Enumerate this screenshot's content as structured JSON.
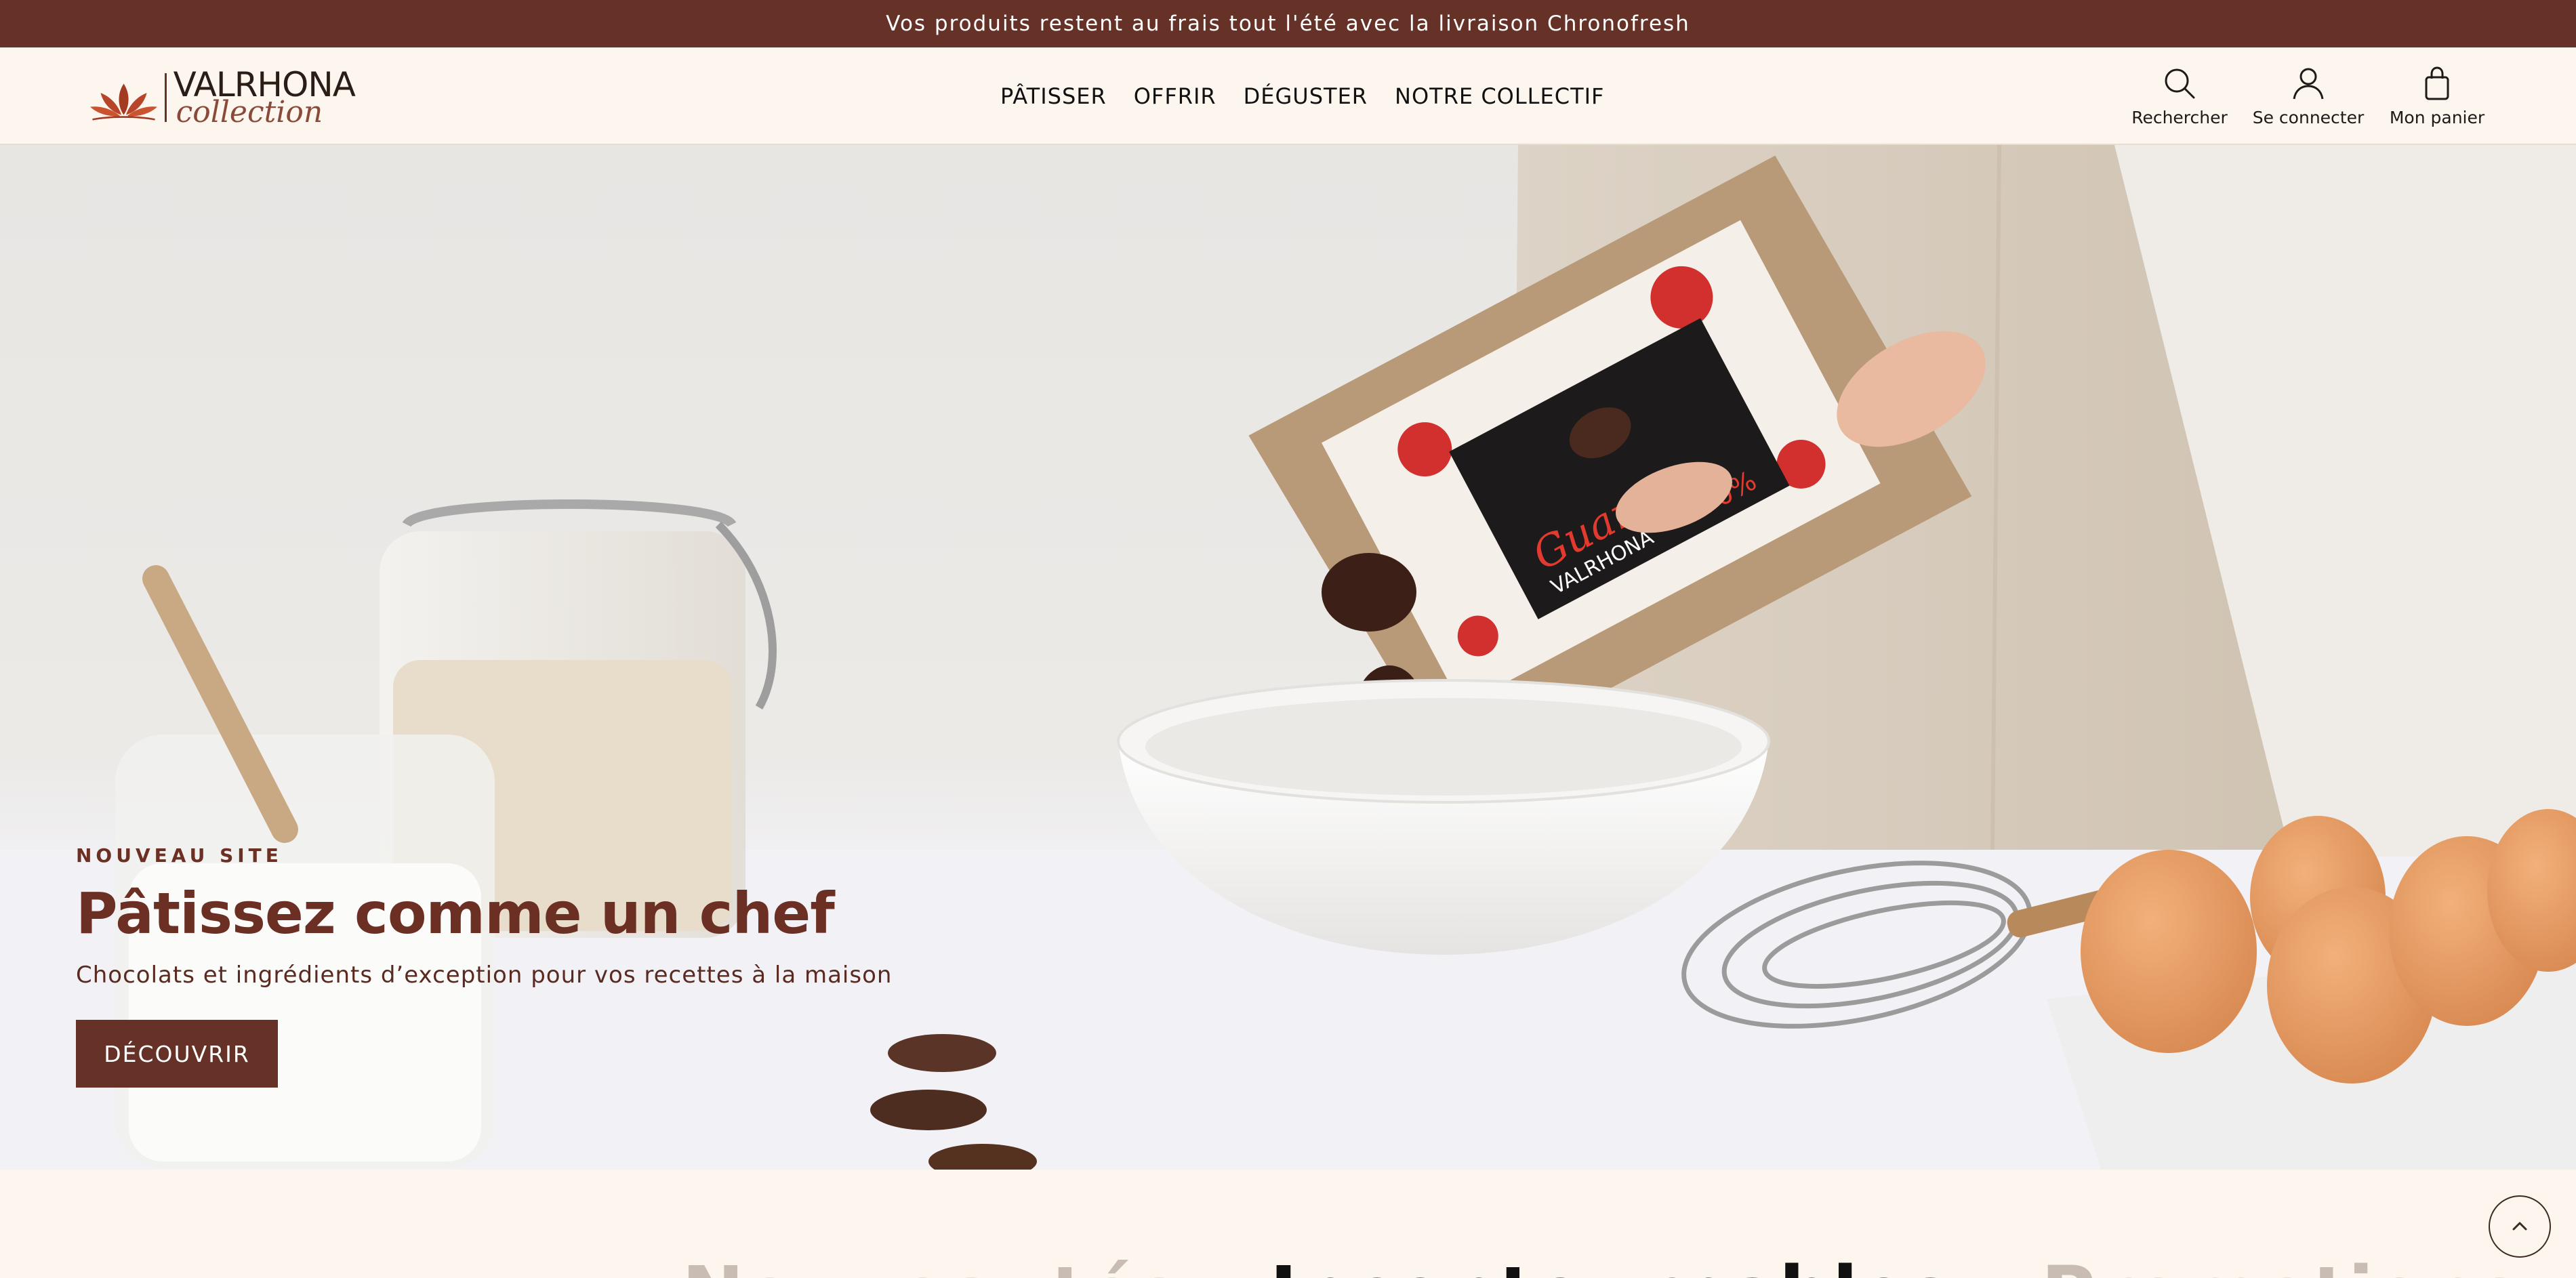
{
  "announcement": {
    "text": "Vos produits restent au frais tout l'été avec la livraison Chronofresh"
  },
  "logo": {
    "brand": "VALRHONA",
    "sub": "collection"
  },
  "nav": {
    "items": [
      {
        "label": "PÂTISSER"
      },
      {
        "label": "OFFRIR"
      },
      {
        "label": "DÉGUSTER"
      },
      {
        "label": "NOTRE COLLECTIF"
      }
    ]
  },
  "tools": {
    "search": {
      "label": "Rechercher",
      "icon": "search-icon"
    },
    "account": {
      "label": "Se connecter",
      "icon": "user-icon"
    },
    "cart": {
      "label": "Mon panier",
      "icon": "bag-icon"
    }
  },
  "hero": {
    "eyebrow": "NOUVEAU SITE",
    "title": "Pâtissez comme un chef",
    "subtitle": "Chocolats et ingrédients d’exception pour vos recettes à la maison",
    "cta": "DÉCOUVRIR",
    "package_brand": "VALRHONA",
    "package_product": "Guanaja",
    "package_percent": "70%"
  },
  "section_tabs": [
    {
      "label": "Nouveautés",
      "state": "inactive"
    },
    {
      "label": "Incontournables",
      "state": "active"
    },
    {
      "label": "Promotions",
      "state": "inactive"
    }
  ],
  "colors": {
    "brand": "#663126",
    "background": "#fdf6ee",
    "text": "#1f1a17"
  }
}
